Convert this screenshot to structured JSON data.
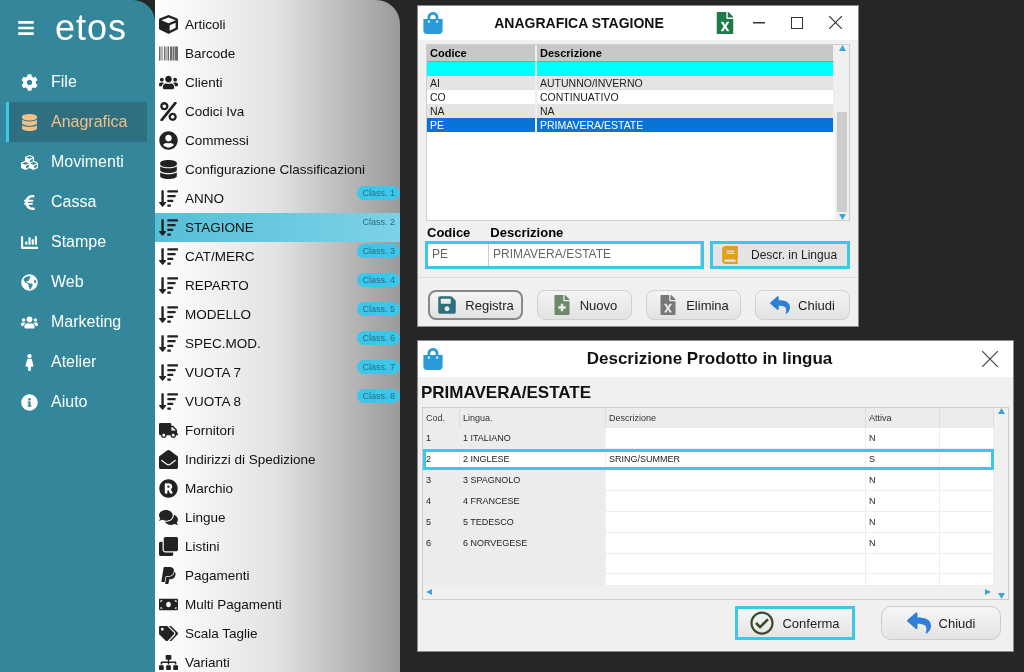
{
  "sidebar": {
    "logo": "etos",
    "items": [
      {
        "label": "File",
        "selected": false
      },
      {
        "label": "Anagrafica",
        "selected": true
      },
      {
        "label": "Movimenti",
        "selected": false
      },
      {
        "label": "Cassa",
        "selected": false
      },
      {
        "label": "Stampe",
        "selected": false
      },
      {
        "label": "Web",
        "selected": false
      },
      {
        "label": "Marketing",
        "selected": false
      },
      {
        "label": "Atelier",
        "selected": false
      },
      {
        "label": "Aiuto",
        "selected": false
      }
    ]
  },
  "submenu": {
    "items": [
      {
        "label": "Articoli",
        "selected": false
      },
      {
        "label": "Barcode",
        "selected": false
      },
      {
        "label": "Clienti",
        "selected": false
      },
      {
        "label": "Codici Iva",
        "selected": false
      },
      {
        "label": "Commessi",
        "selected": false
      },
      {
        "label": "Configurazione Classificazioni",
        "selected": false
      },
      {
        "label": "ANNO",
        "badge": "Class. 1",
        "selected": false
      },
      {
        "label": "STAGIONE",
        "badge": "Class. 2",
        "selected": true
      },
      {
        "label": "CAT/MERC",
        "badge": "Class. 3",
        "selected": false
      },
      {
        "label": "REPARTO",
        "badge": "Class. 4",
        "selected": false
      },
      {
        "label": "MODELLO",
        "badge": "Class. 5",
        "selected": false
      },
      {
        "label": "SPEC.MOD.",
        "badge": "Class. 6",
        "selected": false
      },
      {
        "label": "VUOTA 7",
        "badge": "Class. 7",
        "selected": false
      },
      {
        "label": "VUOTA 8",
        "badge": "Class. 8",
        "selected": false
      },
      {
        "label": "Fornitori",
        "selected": false
      },
      {
        "label": "Indirizzi di Spedizione",
        "selected": false
      },
      {
        "label": "Marchio",
        "selected": false
      },
      {
        "label": "Lingue",
        "selected": false
      },
      {
        "label": "Listini",
        "selected": false
      },
      {
        "label": "Pagamenti",
        "selected": false
      },
      {
        "label": "Multi Pagamenti",
        "selected": false
      },
      {
        "label": "Scala Taglie",
        "selected": false
      },
      {
        "label": "Varianti",
        "selected": false
      }
    ]
  },
  "season_window": {
    "title": "ANAGRAFICA STAGIONE",
    "table": {
      "columns": [
        "Codice",
        "Descrizione"
      ],
      "rows": [
        {
          "kind": "new",
          "cells": [],
          "selected": false
        },
        {
          "kind": "data",
          "cells": [
            "AI",
            "AUTUNNO/INVERNO"
          ],
          "selected": false
        },
        {
          "kind": "data",
          "cells": [
            "CO",
            "CONTINUATIVO"
          ],
          "selected": false
        },
        {
          "kind": "data",
          "cells": [
            "NA",
            "NA"
          ],
          "selected": false
        },
        {
          "kind": "data",
          "cells": [
            "PE",
            "PRIMAVERA/ESTATE"
          ],
          "selected": true
        }
      ]
    },
    "form": {
      "code_label": "Codice",
      "description_label": "Descrizione",
      "code": "PE",
      "description": "PRIMAVERA/ESTATE"
    },
    "language_button": "Descr. in Lingua",
    "buttons": [
      {
        "kind": "save",
        "label": "Registra",
        "focused": true
      },
      {
        "kind": "new",
        "label": "Nuovo",
        "focused": false
      },
      {
        "kind": "delete",
        "label": "Elimina",
        "focused": false
      },
      {
        "kind": "close",
        "label": "Chiudi",
        "focused": false
      }
    ]
  },
  "language_window": {
    "title": "Descrizione Prodotto in lingua",
    "heading": "PRIMAVERA/ESTATE",
    "table": {
      "columns": [
        "Cod.",
        "Lingua.",
        "Descrizione",
        "Attiva"
      ],
      "rows": [
        {
          "cells": [
            "1",
            "1 ITALIANO",
            "",
            "N"
          ],
          "selected": false
        },
        {
          "cells": [
            "2",
            "2 INGLESE",
            "SRING/SUMMER",
            "S"
          ],
          "selected": true
        },
        {
          "cells": [
            "3",
            "3 SPAGNOLO",
            "",
            "N"
          ],
          "selected": false
        },
        {
          "cells": [
            "4",
            "4 FRANCESE",
            "",
            "N"
          ],
          "selected": false
        },
        {
          "cells": [
            "5",
            "5 TEDESCO",
            "",
            "N"
          ],
          "selected": false
        },
        {
          "cells": [
            "6",
            "6 NORVEGESE",
            "",
            "N"
          ],
          "selected": false
        }
      ]
    },
    "buttons": [
      {
        "kind": "confirm",
        "label": "Conferma",
        "focused": true
      },
      {
        "kind": "close",
        "label": "Chiudi",
        "focused": false
      }
    ]
  }
}
